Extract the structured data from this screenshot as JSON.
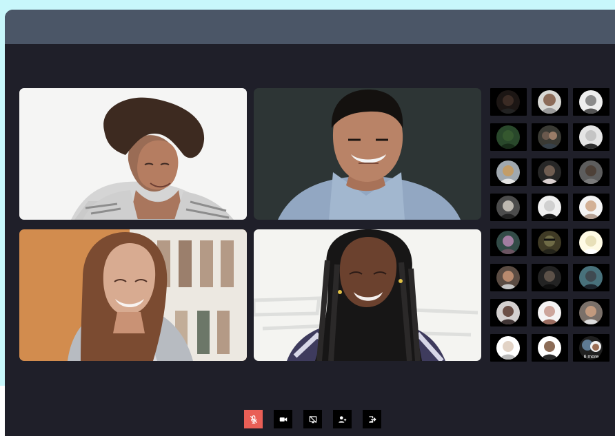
{
  "window": {
    "title": ""
  },
  "participants": {
    "main_tiles": [
      {
        "name": "",
        "background": "#eeeeec",
        "skin": "#ad7659",
        "hair": "#3e2b21",
        "shirt": "#c9c9c9"
      },
      {
        "name": "",
        "background": "#2f3838",
        "skin": "#b88365",
        "hair": "#15120f",
        "shirt": "#98acc6"
      },
      {
        "name": "",
        "background": "#d48d4e",
        "skin": "#d8ab91",
        "hair": "#7a4b31",
        "shirt": "#b8bcc2"
      },
      {
        "name": "",
        "background": "#f3f3ef",
        "skin": "#6e4430",
        "hair": "#1a1818",
        "shirt": "#403c61"
      }
    ],
    "thumbnail_count": 24,
    "more_label": "6 more",
    "thumbnail_colors": [
      "#3b2b24",
      "#8c6c59",
      "#8b8b8b",
      "#35582f",
      "#6a594d",
      "#c4c4c4",
      "#c39d68",
      "#6f5d51",
      "#4d4037",
      "#bdb8b0",
      "#d0d0d0",
      "#d3b196",
      "#a27da1",
      "#6f6b46",
      "#e8e0b8",
      "#b98a6e",
      "#5c5148",
      "#3f4a51",
      "#6b4f46",
      "#cda59b",
      "#c29a7e",
      "#e2d3c6",
      "#8c6c57",
      "#5e7a93"
    ]
  },
  "controls": {
    "mic_icon": "mic-off-icon",
    "camera_icon": "video-camera-icon",
    "screen_icon": "screen-share-off-icon",
    "participants_icon": "participants-icon",
    "leave_icon": "leave-icon",
    "mic_color": "#e95f56"
  }
}
